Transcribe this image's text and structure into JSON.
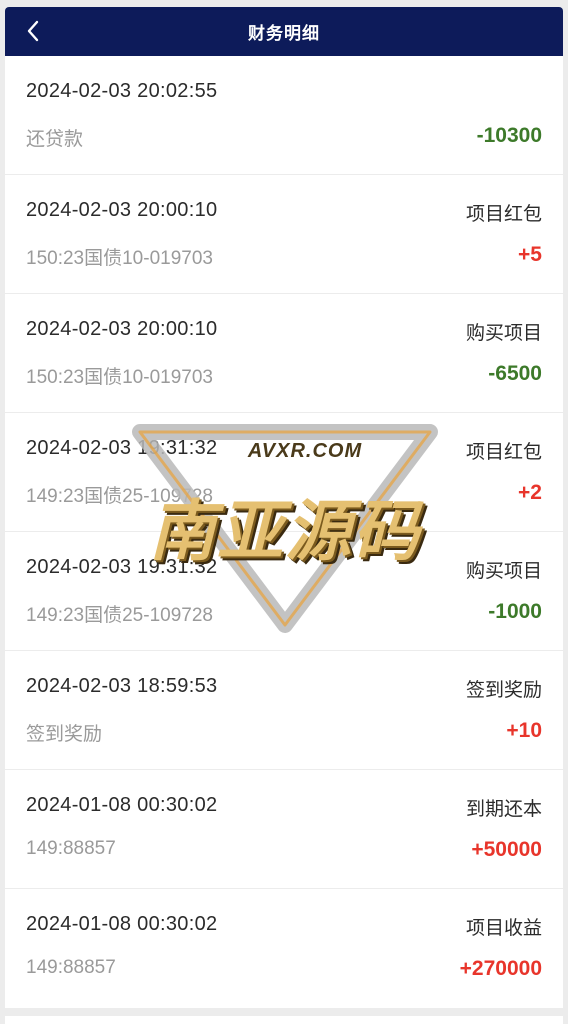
{
  "header": {
    "title": "财务明细",
    "back_icon": "chevron-left-icon"
  },
  "records": [
    {
      "date": "2024-02-03 20:02:55",
      "type": "",
      "desc": "还贷款",
      "amount": "-10300",
      "sign": "neg"
    },
    {
      "date": "2024-02-03 20:00:10",
      "type": "项目红包",
      "desc": "150:23国债10-019703",
      "amount": "+5",
      "sign": "pos"
    },
    {
      "date": "2024-02-03 20:00:10",
      "type": "购买项目",
      "desc": "150:23国债10-019703",
      "amount": "-6500",
      "sign": "neg"
    },
    {
      "date": "2024-02-03 19:31:32",
      "type": "项目红包",
      "desc": "149:23国债25-109728",
      "amount": "+2",
      "sign": "pos"
    },
    {
      "date": "2024-02-03 19:31:32",
      "type": "购买项目",
      "desc": "149:23国债25-109728",
      "amount": "-1000",
      "sign": "neg"
    },
    {
      "date": "2024-02-03 18:59:53",
      "type": "签到奖励",
      "desc": "签到奖励",
      "amount": "+10",
      "sign": "pos"
    },
    {
      "date": "2024-01-08 00:30:02",
      "type": "到期还本",
      "desc": "149:88857",
      "amount": "+50000",
      "sign": "pos"
    },
    {
      "date": "2024-01-08 00:30:02",
      "type": "项目收益",
      "desc": "149:88857",
      "amount": "+270000",
      "sign": "pos"
    }
  ],
  "colors": {
    "header_bg": "#0d1b5a",
    "negative": "#3d7a2a",
    "positive": "#e8352b"
  },
  "watermark": {
    "url": "AVXR.COM",
    "text": "南亚源码"
  }
}
